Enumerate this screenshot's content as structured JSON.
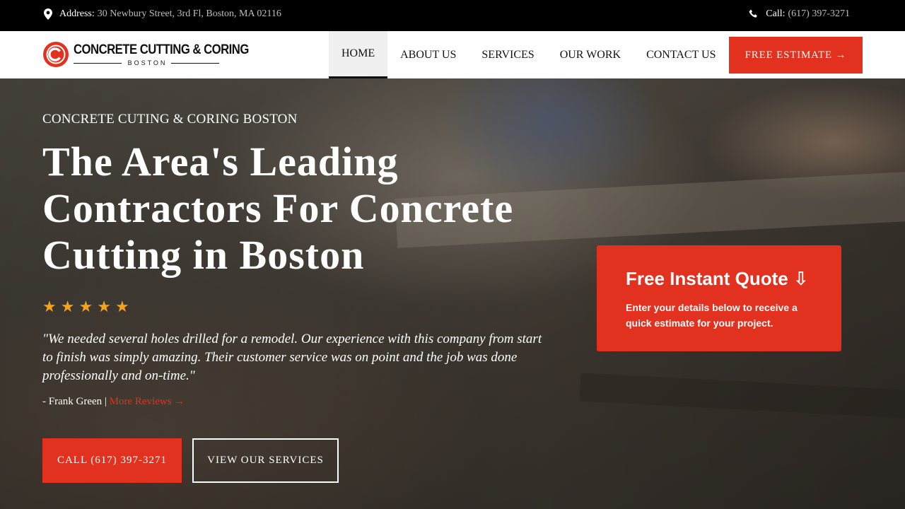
{
  "topbar": {
    "address_label": "Address:",
    "address_value": "30 Newbury Street, 3rd Fl, Boston, MA 02116",
    "call_label": "Call:",
    "call_value": "(617) 397-3271"
  },
  "logo": {
    "name": "CONCRETE CUTTING & CORING",
    "sub": "BOSTON"
  },
  "nav": {
    "items": [
      "HOME",
      "ABOUT US",
      "SERVICES",
      "OUR WORK",
      "CONTACT US"
    ],
    "active": "HOME",
    "cta": "FREE ESTIMATE →"
  },
  "hero": {
    "eyebrow": "CONCRETE CUTING & CORING BOSTON",
    "headline": "The Area's Leading Contractors For Concrete Cutting in Boston",
    "stars": [
      "★",
      "★",
      "★",
      "★",
      "★"
    ],
    "rating_stars": 5,
    "testimonial": "\"We needed several holes drilled for a remodel. Our experience with this company from start to finish was simply amazing. Their customer service was on point and the job was done professionally and on-time.\"",
    "author": "- Frank Green",
    "separator": "|",
    "more_reviews": "More Reviews →",
    "call_button": "CALL (617) 397-3271",
    "services_button": "VIEW OUR SERVICES"
  },
  "quote_card": {
    "title": "Free Instant Quote ⇩",
    "text": "Enter your details below to receive a quick estimate for your project."
  },
  "colors": {
    "accent": "#e2311e",
    "star": "#f4a41c",
    "topbar": "#000000"
  },
  "icons": {
    "address": "map-pin-icon",
    "call": "phone-icon"
  }
}
